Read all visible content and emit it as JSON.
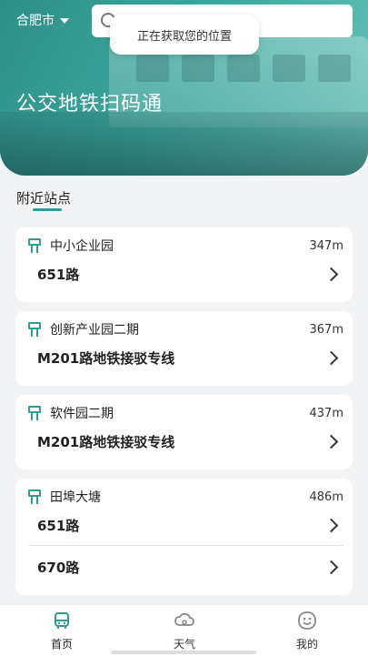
{
  "header": {
    "city": "合肥市",
    "search_placeholder": "",
    "toast": "正在获取您的位置",
    "hero_title": "公交地铁扫码通"
  },
  "section": {
    "title": "附近站点"
  },
  "stations": [
    {
      "name": "中小企业园",
      "distance": "347m",
      "routes": [
        "651路"
      ]
    },
    {
      "name": "创新产业园二期",
      "distance": "367m",
      "routes": [
        "M201路地铁接驳专线"
      ]
    },
    {
      "name": "软件园二期",
      "distance": "437m",
      "routes": [
        "M201路地铁接驳专线"
      ]
    },
    {
      "name": "田埠大塘",
      "distance": "486m",
      "routes": [
        "651路",
        "670路"
      ]
    }
  ],
  "tabs": [
    {
      "label": "首页",
      "icon": "bus-icon",
      "active": true
    },
    {
      "label": "天气",
      "icon": "cloud-icon",
      "active": false
    },
    {
      "label": "我的",
      "icon": "smiley-icon",
      "active": false
    }
  ],
  "colors": {
    "accent": "#2f9d93",
    "hero": "#3aa79c"
  }
}
